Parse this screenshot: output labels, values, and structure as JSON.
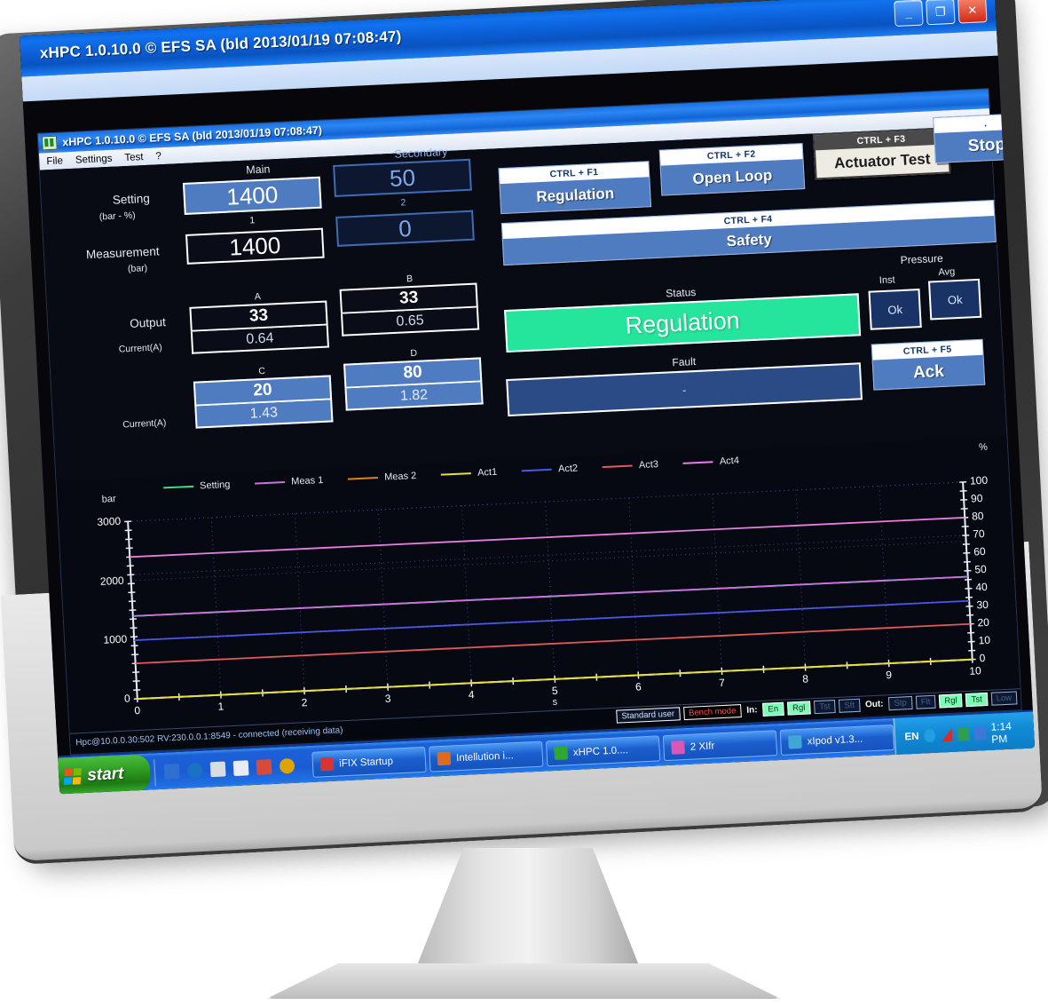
{
  "window": {
    "outer_title": "xHPC 1.0.10.0 © EFS SA (bld 2013/01/19 07:08:47)",
    "minimize": "_",
    "maximize": "❐",
    "close": "✕",
    "app_title": "xHPC 1.0.10.0 © EFS SA (bld 2013/01/19 07:08:47)",
    "menu": [
      "File",
      "Settings",
      "Test",
      "?"
    ]
  },
  "panel": {
    "col_main": "Main",
    "col_secondary": "Secondary",
    "setting_label": "Setting",
    "setting_units": "(bar - %)",
    "setting_main": "1400",
    "setting_secondary": "50",
    "meas_label": "Measurement",
    "meas_units": "(bar)",
    "meas_hdr_1": "1",
    "meas_hdr_2": "2",
    "meas_1": "1400",
    "meas_2": "0",
    "output_label": "Output",
    "current_label": "Current(A)",
    "current_label2": "Current(A)",
    "out_A_hdr": "A",
    "out_A_val": "33",
    "out_A_cur": "0.64",
    "out_B_hdr": "B",
    "out_B_val": "33",
    "out_B_cur": "0.65",
    "out_C_hdr": "C",
    "out_C_val": "20",
    "out_C_cur": "1.43",
    "out_D_hdr": "D",
    "out_D_val": "80",
    "out_D_cur": "1.82"
  },
  "buttons": {
    "regulation": {
      "shortcut": "CTRL + F1",
      "label": "Regulation"
    },
    "open_loop": {
      "shortcut": "CTRL + F2",
      "label": "Open Loop"
    },
    "actuator_test": {
      "shortcut": "CTRL + F3",
      "label": "Actuator Test"
    },
    "stop": {
      "shortcut": ".",
      "label": "Stop"
    },
    "safety": {
      "shortcut": "CTRL + F4",
      "label": "Safety"
    },
    "ack": {
      "shortcut": "CTRL + F5",
      "label": "Ack"
    }
  },
  "status": {
    "status_label": "Status",
    "status_value": "Regulation",
    "status_color": "#24e59b",
    "fault_label": "Fault",
    "fault_value": "-",
    "pressure_label": "Pressure",
    "inst_label": "Inst",
    "avg_label": "Avg",
    "inst_value": "Ok",
    "avg_value": "Ok"
  },
  "statusbar": {
    "connection": "Hpc@10.0.0.30:502 RV:230.0.0.1:8549 - connected (receiving data)",
    "user": "Standard user",
    "mode": "Bench mode",
    "in_label": "In:",
    "in_flags": [
      {
        "label": "En",
        "on": true
      },
      {
        "label": "Rgl",
        "on": true
      },
      {
        "label": "Tst",
        "on": false
      },
      {
        "label": "Sft",
        "on": false
      }
    ],
    "out_label": "Out:",
    "out_flags": [
      {
        "label": "Stp",
        "on": false
      },
      {
        "label": "Flt",
        "on": false
      },
      {
        "label": "Rgl",
        "on": true
      },
      {
        "label": "Tst",
        "on": true
      },
      {
        "label": "Low",
        "on": false
      }
    ]
  },
  "taskbar": {
    "start": "start",
    "tasks": [
      {
        "label": "iFIX Startup",
        "icon_color": "#d93434"
      },
      {
        "label": "Intellution i...",
        "icon_color": "#e06a1c"
      },
      {
        "label": "xHPC 1.0....",
        "icon_color": "#2fa82f"
      },
      {
        "label": "2 XIfr",
        "icon_color": "#d957b5"
      },
      {
        "label": "xIpod v1.3...",
        "icon_color": "#3fa6d6"
      }
    ],
    "lang": "EN",
    "clock": "1:14 PM"
  },
  "chart_data": {
    "type": "line",
    "title": "",
    "xlabel": "s",
    "ylabel": "bar",
    "y2label": "%",
    "xlim": [
      0,
      10
    ],
    "ylim": [
      0,
      3000
    ],
    "y2lim": [
      0,
      100
    ],
    "xticks": [
      0,
      1,
      2,
      3,
      4,
      5,
      6,
      7,
      8,
      9,
      10
    ],
    "yticks": [
      0,
      1000,
      2000,
      3000
    ],
    "y2ticks": [
      0,
      10,
      20,
      30,
      40,
      50,
      60,
      70,
      80,
      90,
      100
    ],
    "grid": true,
    "legend_position": "top",
    "x": [
      0,
      1,
      2,
      3,
      4,
      5,
      6,
      7,
      8,
      9,
      10
    ],
    "series": [
      {
        "name": "Setting",
        "color": "#3ddc84",
        "axis": "left",
        "values": [
          1400,
          1400,
          1400,
          1400,
          1400,
          1400,
          1400,
          1400,
          1400,
          1400,
          1400
        ]
      },
      {
        "name": "Meas 1",
        "color": "#cf6fe0",
        "axis": "left",
        "values": [
          1400,
          1400,
          1402,
          1398,
          1401,
          1400,
          1403,
          1399,
          1400,
          1402,
          1400
        ]
      },
      {
        "name": "Meas 2",
        "color": "#e08020",
        "axis": "left",
        "values": [
          0,
          0,
          0,
          0,
          0,
          0,
          0,
          0,
          0,
          0,
          0
        ]
      },
      {
        "name": "Act1",
        "color": "#e3e33a",
        "axis": "right",
        "values": [
          0,
          0,
          0,
          0,
          0,
          0,
          0,
          0,
          0,
          0,
          0
        ]
      },
      {
        "name": "Act2",
        "color": "#4a57e8",
        "axis": "right",
        "values": [
          33,
          33,
          33,
          33,
          33,
          33,
          33,
          33,
          33,
          33,
          33
        ]
      },
      {
        "name": "Act3",
        "color": "#e35a5a",
        "axis": "right",
        "values": [
          20,
          20,
          20,
          20,
          20,
          20,
          20,
          20,
          20,
          20,
          20
        ]
      },
      {
        "name": "Act4",
        "color": "#e87fe0",
        "axis": "right",
        "values": [
          80,
          80,
          80,
          80,
          80,
          80,
          80,
          80,
          80,
          80,
          80
        ]
      }
    ]
  }
}
